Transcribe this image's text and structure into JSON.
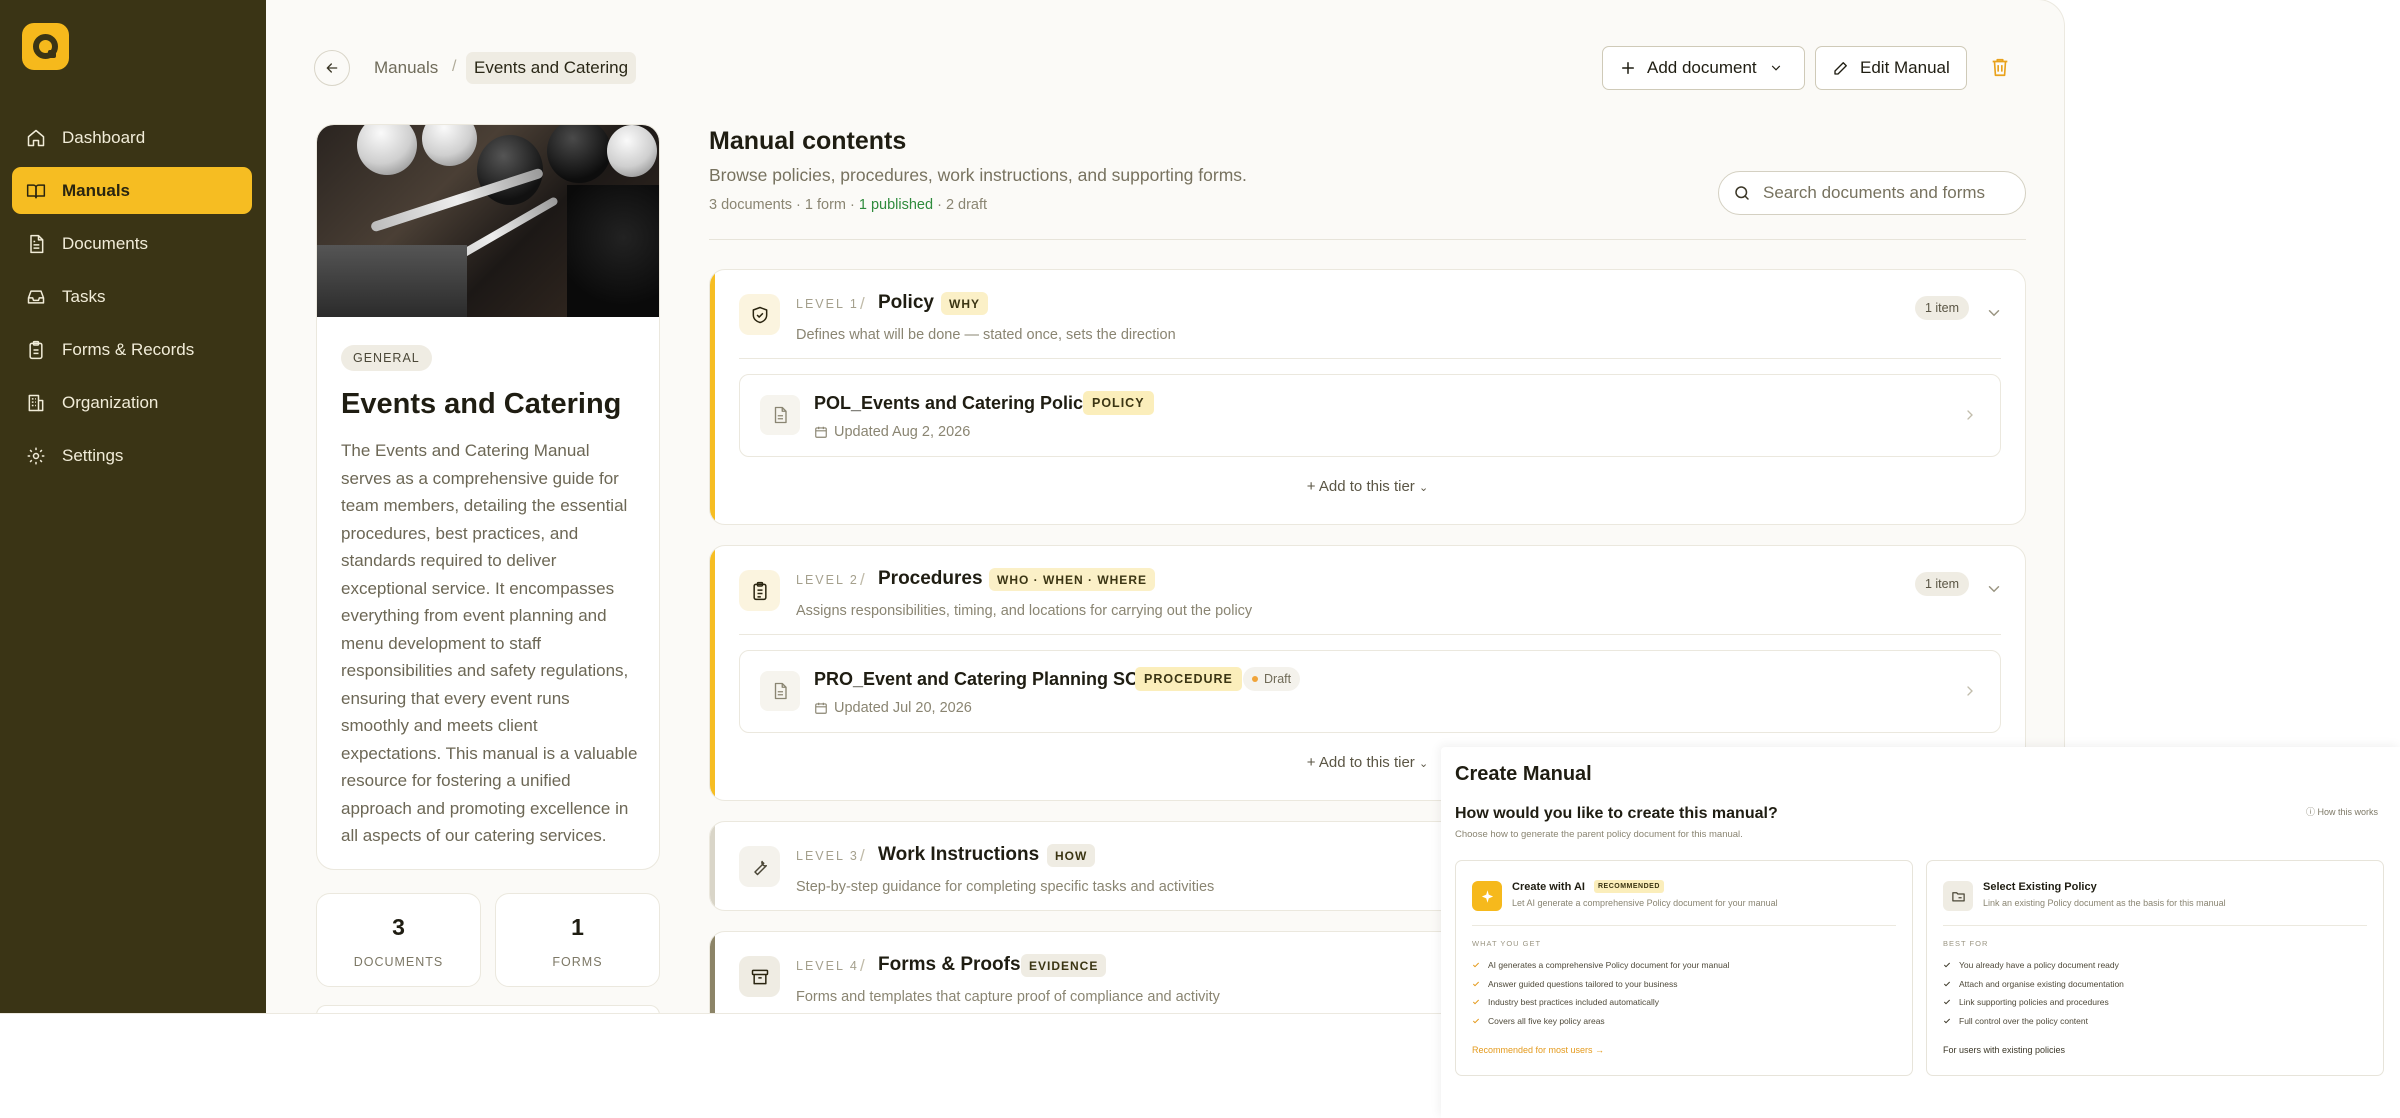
{
  "sidebar": {
    "items": [
      {
        "label": "Dashboard",
        "icon": "home-icon"
      },
      {
        "label": "Manuals",
        "icon": "book-icon",
        "active": true
      },
      {
        "label": "Documents",
        "icon": "document-icon"
      },
      {
        "label": "Tasks",
        "icon": "inbox-icon"
      },
      {
        "label": "Forms & Records",
        "icon": "clipboard-icon"
      },
      {
        "label": "Organization",
        "icon": "building-icon"
      },
      {
        "label": "Settings",
        "icon": "gear-icon"
      }
    ]
  },
  "breadcrumb": {
    "parent": "Manuals",
    "separator": "/",
    "current": "Events and Catering"
  },
  "toolbar": {
    "add_document": "Add document",
    "edit_manual": "Edit Manual"
  },
  "manual": {
    "tag": "GENERAL",
    "title": "Events and Catering",
    "description": "The Events and Catering Manual serves as a comprehensive guide for team members, detailing the essential procedures, best practices, and standards required to deliver exceptional service. It encompasses everything from event planning and menu development to staff responsibilities and safety regulations, ensuring that every event runs smoothly and meets client expectations. This manual is a valuable resource for fostering a unified approach and promoting excellence in all aspects of our catering services.",
    "stats": [
      {
        "value": "3",
        "label": "DOCUMENTS"
      },
      {
        "value": "1",
        "label": "FORMS"
      }
    ]
  },
  "contents": {
    "title": "Manual contents",
    "subtitle": "Browse policies, procedures, work instructions, and supporting forms.",
    "meta_docs": "3 documents · 1 form · ",
    "meta_published": "1 published",
    "meta_draft": " · 2 draft",
    "search_placeholder": "Search documents and forms"
  },
  "tiers": [
    {
      "level": "LEVEL 1",
      "name": "Policy",
      "tag": "WHY",
      "desc": "Defines what will be done — stated once, sets the direction",
      "count": "1 item",
      "color": "#f6bd22",
      "doc": {
        "title": "POL_Events and Catering Policy",
        "tag": "POLICY",
        "updated": "Updated Aug 2, 2026"
      },
      "add": "Add to this tier"
    },
    {
      "level": "LEVEL 2",
      "name": "Procedures",
      "tag": "WHO · WHEN · WHERE",
      "desc": "Assigns responsibilities, timing, and locations for carrying out the policy",
      "count": "1 item",
      "color": "#f6bd22",
      "doc": {
        "title": "PRO_Event and Catering Planning SOP",
        "tag": "PROCEDURE",
        "status": "Draft",
        "updated": "Updated Jul 20, 2026"
      },
      "add": "Add to this tier"
    },
    {
      "level": "LEVEL 3",
      "name": "Work Instructions",
      "tag": "HOW",
      "desc": "Step-by-step guidance for completing specific tasks and activities",
      "color": "#d9d5c8"
    },
    {
      "level": "LEVEL 4",
      "name": "Forms & Proofs",
      "tag": "EVIDENCE",
      "desc": "Forms and templates that capture proof of compliance and activity",
      "color": "#8c8467"
    }
  ],
  "modal": {
    "title": "Create Manual",
    "question": "How would you like to create this manual?",
    "subtitle": "Choose how to generate the parent policy document for this manual.",
    "how": "How this works",
    "ai": {
      "title": "Create with AI",
      "badge": "RECOMMENDED",
      "desc": "Let AI generate a comprehensive Policy document for your manual",
      "section": "WHAT YOU GET",
      "items": [
        "AI generates a comprehensive Policy document for your manual",
        "Answer guided questions tailored to your business",
        "Industry best practices included automatically",
        "Covers all five key policy areas"
      ],
      "footer": "Recommended for most users →"
    },
    "existing": {
      "title": "Select Existing Policy",
      "desc": "Link an existing Policy document as the basis for this manual",
      "section": "BEST FOR",
      "items": [
        "You already have a policy document ready",
        "Attach and organise existing documentation",
        "Link supporting policies and procedures",
        "Full control over the policy content"
      ],
      "footer": "For users with existing policies"
    }
  }
}
